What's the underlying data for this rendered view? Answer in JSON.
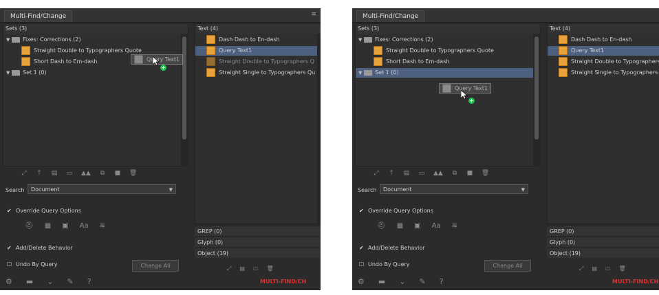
{
  "panels": [
    {
      "title": "Multi-Find/Change",
      "sets_header": "Sets (3)",
      "texts_header": "Text (4)",
      "sets_rows": [
        {
          "label": "Fixes: Corrections (2)",
          "type": "folder",
          "expanded": true
        },
        {
          "label": "Straight Double to Typographers Quote",
          "type": "query"
        },
        {
          "label": "Short Dash to Em-dash",
          "type": "query"
        },
        {
          "label": "Set 1 (0)",
          "type": "folder",
          "expanded": true
        }
      ],
      "texts_rows": [
        {
          "label": "Dash Dash to En-dash"
        },
        {
          "label": "Query Text1"
        },
        {
          "label": "Straight Double to Typographers Q"
        },
        {
          "label": "Straight Single to Typographers Qu"
        }
      ],
      "drag_ghost": "Query Text1",
      "search_label": "Search",
      "search_value": "Document",
      "override_label": "Override Query Options",
      "add_delete_label": "Add/Delete Behavior",
      "undo_label": "Undo By Query",
      "change_all_label": "Change All",
      "grep_label": "GREP (0)",
      "glyph_label": "Glyph (0)",
      "object_label": "Object (19)",
      "red_label": "MULTI-FIND/CH"
    },
    {
      "title": "Multi-Find/Change",
      "sets_header": "Sets (3)",
      "texts_header": "Text (4)",
      "sets_rows": [
        {
          "label": "Fixes: Corrections (2)",
          "type": "folder",
          "expanded": true
        },
        {
          "label": "Straight Double to Typographers Quote",
          "type": "query"
        },
        {
          "label": "Short Dash to Em-dash",
          "type": "query"
        },
        {
          "label": "Set 1 (0)",
          "type": "folder",
          "expanded": true
        }
      ],
      "texts_rows": [
        {
          "label": "Dash Dash to En-dash"
        },
        {
          "label": "Query Text1"
        },
        {
          "label": "Straight Double to Typographers Q"
        },
        {
          "label": "Straight Single to Typographers Qu"
        }
      ],
      "drag_ghost": "Query Text1",
      "search_label": "Search",
      "search_value": "Document",
      "override_label": "Override Query Options",
      "add_delete_label": "Add/Delete Behavior",
      "undo_label": "Undo By Query",
      "change_all_label": "Change All",
      "grep_label": "GREP (0)",
      "glyph_label": "Glyph (0)",
      "object_label": "Object (19)",
      "red_label": "MULTI-FIND/CH"
    }
  ],
  "icons": {
    "folder": "folder-icon",
    "query": "query-icon",
    "cursor": "cursor-icon",
    "plus": "plus-icon"
  },
  "colors": {
    "panel_bg": "#2b2b2b",
    "highlight": "#4d6080",
    "query_orange": "#e8a23a",
    "accent_red": "#e03030",
    "drop_green": "#22c24a"
  }
}
